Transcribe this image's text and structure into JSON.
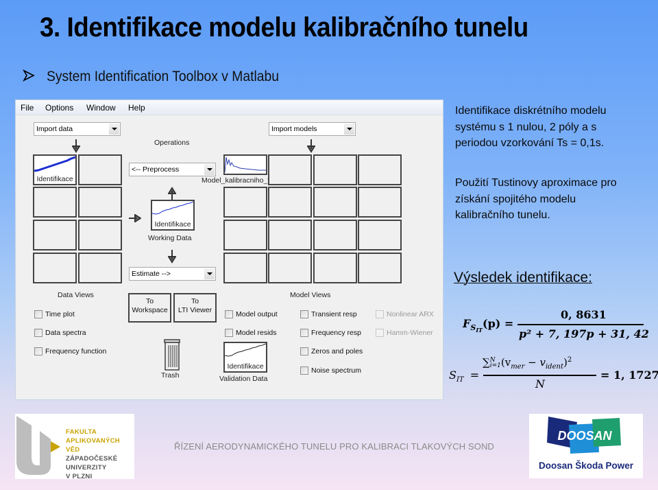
{
  "slide": {
    "title": "3. Identifikace modelu kalibračního tunelu",
    "bullet_icon": "arrow-bullet",
    "subtitle": "System Identification Toolbox v Matlabu"
  },
  "matlab_window": {
    "menu": [
      "File",
      "Options",
      "Window",
      "Help"
    ],
    "import_data": "Import data",
    "import_models": "Import models",
    "operations_label": "Operations",
    "preprocess": "<-- Preprocess",
    "estimate": "Estimate -->",
    "data_board": {
      "cells": [
        {
          "label": "Identifikace",
          "has_plot": true
        },
        {
          "label": ""
        },
        {
          "label": ""
        },
        {
          "label": ""
        },
        {
          "label": ""
        },
        {
          "label": ""
        },
        {
          "label": ""
        },
        {
          "label": ""
        }
      ]
    },
    "model_board": {
      "first_cell_label": "Model_kalibracniho_tunelu"
    },
    "working_data": {
      "cell_label": "Identifikace",
      "caption": "Working Data"
    },
    "validation_data": {
      "cell_label": "Identifikace",
      "caption": "Validation Data"
    },
    "data_views": {
      "title": "Data Views",
      "options": [
        {
          "label": "Time plot",
          "checked": false
        },
        {
          "label": "Data spectra",
          "checked": false
        },
        {
          "label": "Frequency function",
          "checked": false
        }
      ]
    },
    "buttons": {
      "to_workspace": [
        "To",
        "Workspace"
      ],
      "to_lti_viewer": [
        "To",
        "LTI Viewer"
      ]
    },
    "trash_label": "Trash",
    "model_views": {
      "title": "Model Views",
      "col1": [
        {
          "label": "Model output",
          "checked": false
        },
        {
          "label": "Model resids",
          "checked": false
        }
      ],
      "col2": [
        {
          "label": "Transient resp",
          "checked": false
        },
        {
          "label": "Frequency resp",
          "checked": false
        },
        {
          "label": "Zeros and poles",
          "checked": false
        },
        {
          "label": "Noise spectrum",
          "checked": false
        }
      ],
      "col3": [
        {
          "label": "Nonlinear ARX",
          "checked": false,
          "disabled": true
        },
        {
          "label": "Hamm-Wiener",
          "checked": false,
          "disabled": true
        }
      ]
    }
  },
  "description": {
    "para1": [
      "Identifikace diskrétního modelu",
      "systému s 1 nulou, 2 póly a s",
      "periodou vzorkování Ts = 0,1s."
    ],
    "para2": [
      "Použití Tustinovy aproximace pro",
      "získání spojitého modelu",
      "kalibračního tunelu."
    ]
  },
  "result": {
    "heading": "Výsledek identifikace:",
    "transfer_function": {
      "lhs": "F",
      "lhs_sub": "S",
      "lhs_subsub": "IT",
      "arg": "(p) =",
      "numerator": "0, 8631",
      "denominator": "p² + 7, 197p + 31, 42"
    },
    "criterion": {
      "lhs": "S",
      "lhs_sub": "IT",
      "eq": "=",
      "numerator": "∑ᴺᵢ₌₁(v_mer − v_ident)²",
      "num_sum": "∑",
      "num_sup": "N",
      "num_sub": "i=1",
      "num_body1": "(v",
      "num_sub1": "mer",
      "num_mid": " − v",
      "num_sub2": "ident",
      "num_end": ")",
      "num_pow": "2",
      "denominator": "N",
      "value": "= 1, 1727"
    }
  },
  "footer": {
    "text": "ŘÍZENÍ AERODYNAMICKÉHO TUNELU PRO KALIBRACI TLAKOVÝCH SOND",
    "left_logo": [
      "FAKULTA",
      "APLIKOVANÝCH VĚD",
      "ZÁPADOČESKÉ",
      "UNIVERZITY",
      "V PLZNI"
    ],
    "right_logo": {
      "brand": "DOOSAN",
      "caption": "Doosan Škoda Power"
    }
  },
  "colors": {
    "plot_line": "#1a2fd0",
    "fav_gold": "#c9a300",
    "doosan_navy": "#1a2a7a",
    "doosan_blue": "#1f8fd8",
    "doosan_green": "#1f9e6e"
  }
}
